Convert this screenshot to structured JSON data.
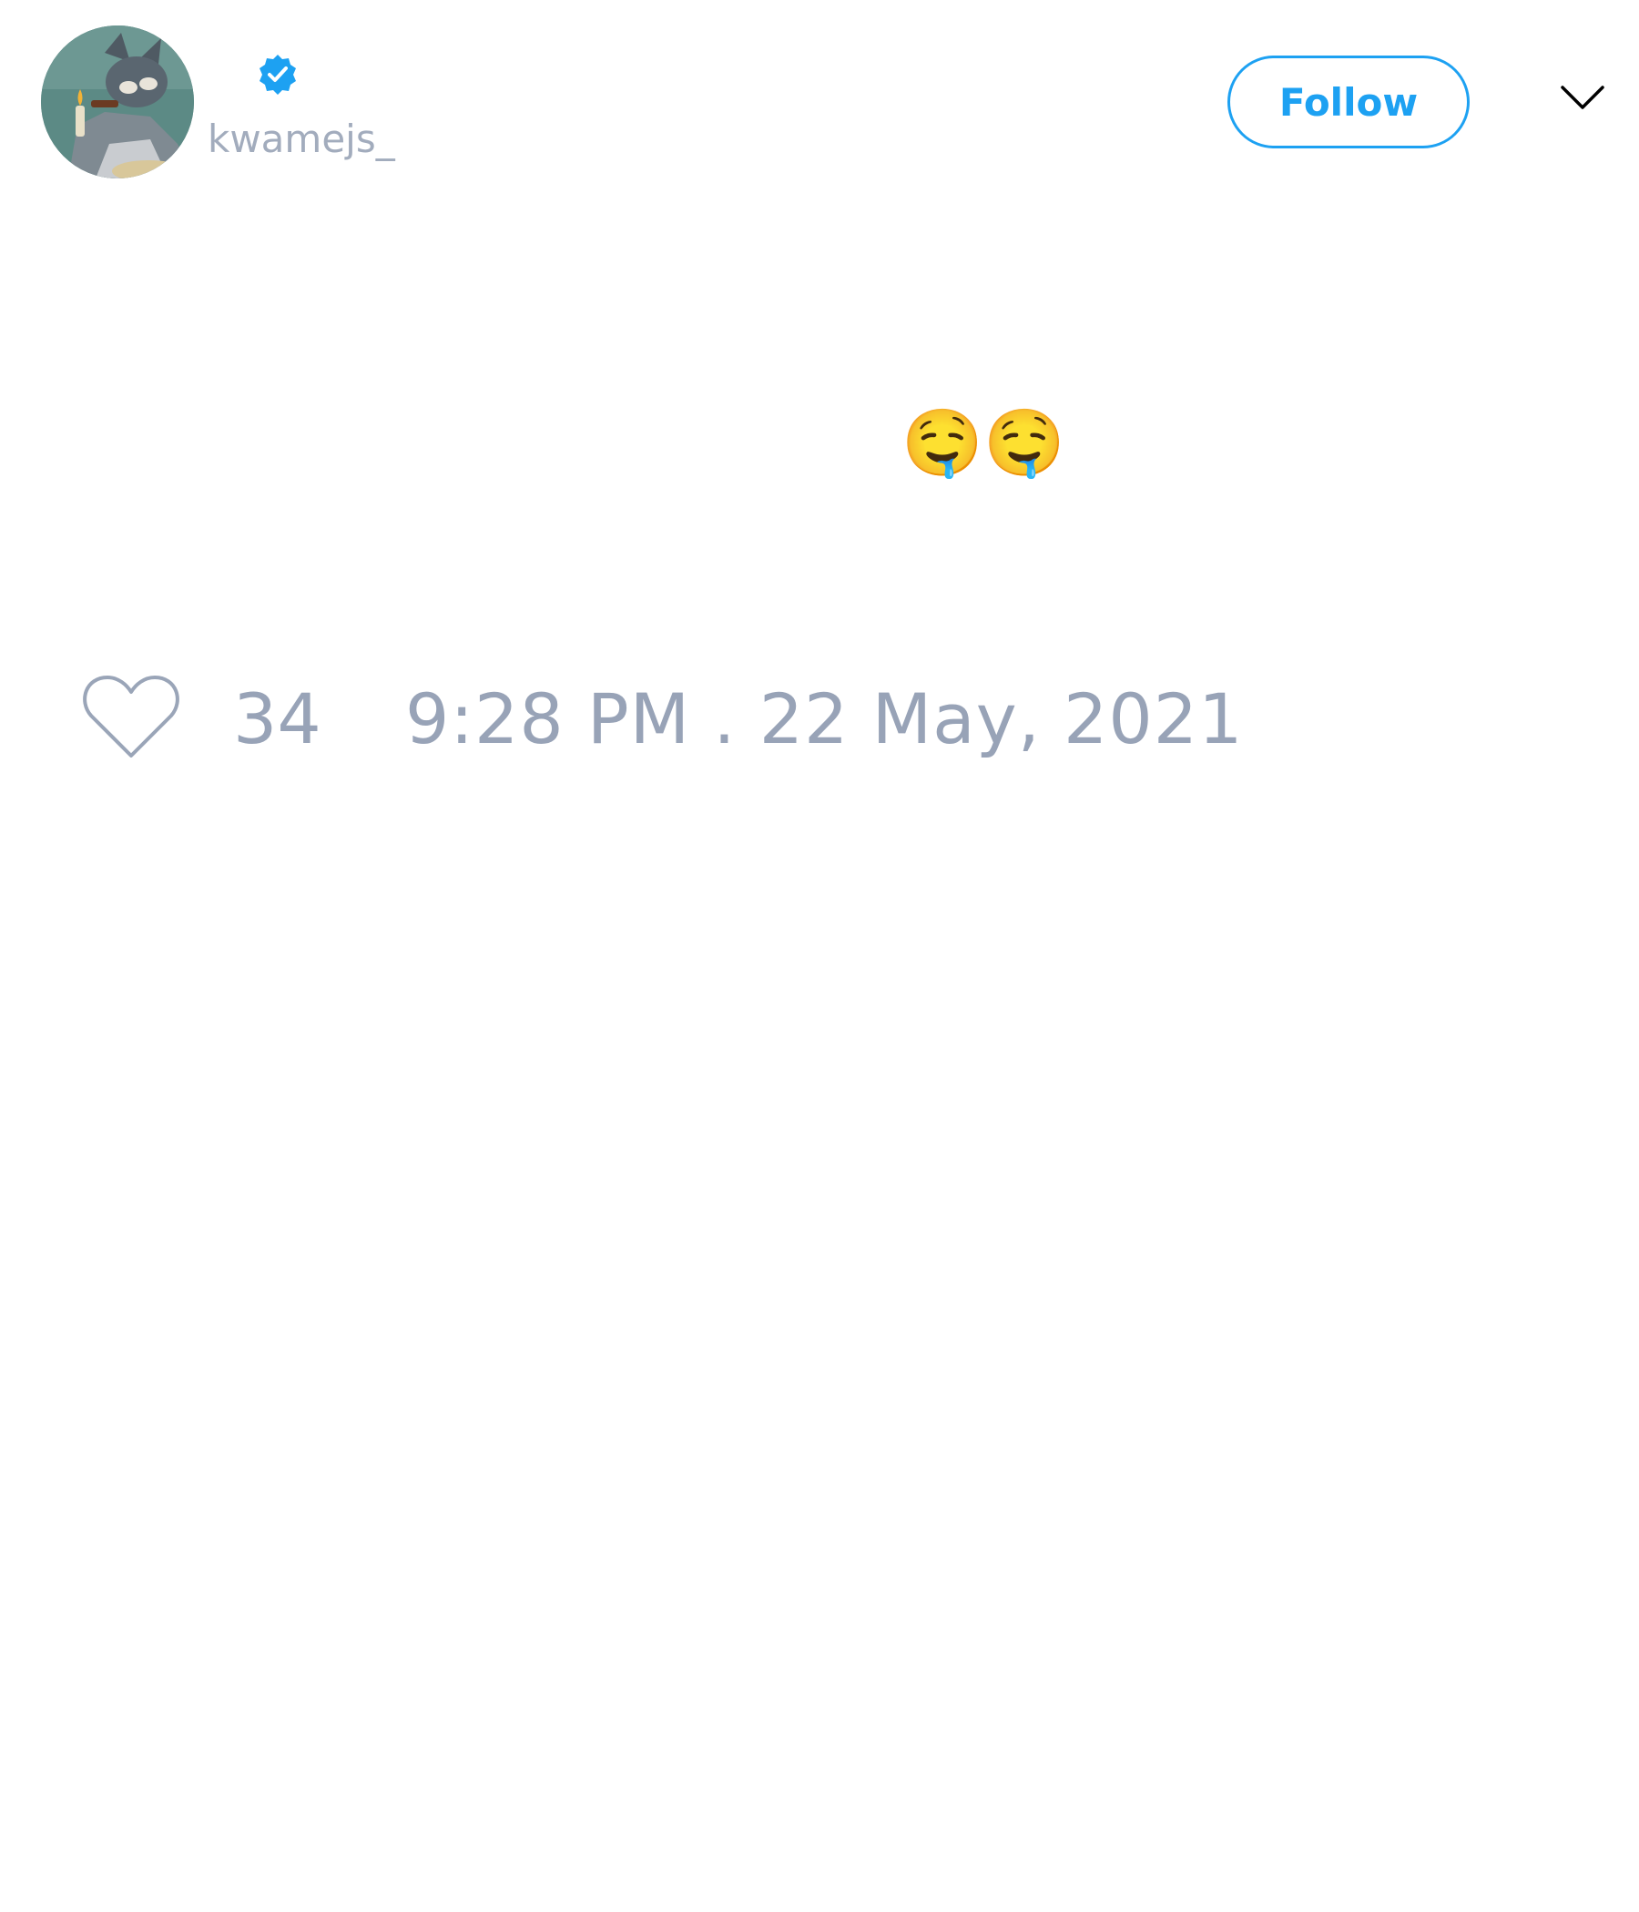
{
  "author": {
    "handle": "kwamejs_",
    "verified": true,
    "avatar": "cartoon-cat-avatar"
  },
  "header": {
    "follow_label": "Follow",
    "menu_icon": "chevron-down-icon"
  },
  "tweet": {
    "text": "🤤🤤"
  },
  "footer": {
    "like_icon": "heart-outline-icon",
    "like_count": "34",
    "timestamp": "9:28 PM . 22 May, 2021"
  },
  "colors": {
    "accent": "#1da1f2",
    "muted_text": "#98a3b7",
    "background": "#ffffff"
  }
}
